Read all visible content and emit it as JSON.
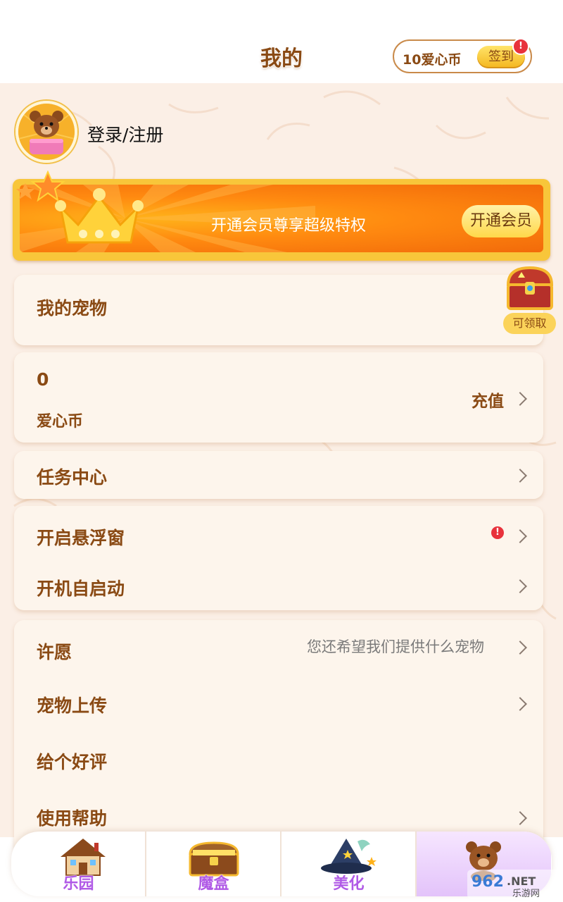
{
  "header": {
    "title": "我的",
    "coin_label": "10爱心币",
    "signin_label": "签到",
    "signin_badge": "!"
  },
  "profile": {
    "login_label": "登录/注册"
  },
  "vip": {
    "text": "开通会员尊享超级特权",
    "button_label": "开通会员"
  },
  "pets": {
    "label": "我的宠物",
    "chest_label": "可领取"
  },
  "coins": {
    "value": "0",
    "label": "爱心币",
    "recharge_label": "充值"
  },
  "menu": {
    "task_center": "任务中心",
    "floating_window": "开启悬浮窗",
    "floating_badge": "!",
    "auto_start": "开机自启动",
    "wish": "许愿",
    "wish_hint": "您还希望我们提供什么宠物",
    "pet_upload": "宠物上传",
    "good_review": "给个好评",
    "help": "使用帮助"
  },
  "tabs": [
    {
      "label": "乐园",
      "icon": "house-icon"
    },
    {
      "label": "魔盒",
      "icon": "treasure-box-icon"
    },
    {
      "label": "美化",
      "icon": "wizard-hat-icon"
    },
    {
      "label": "",
      "icon": "bear-icon",
      "active": true
    }
  ],
  "watermark": {
    "brand": "962.NET",
    "sub": "乐游网"
  },
  "colors": {
    "accent_brown": "#8a4a14",
    "vip_orange": "#f26a0a",
    "tab_purple": "#b05ae6",
    "badge_red": "#e8323c",
    "card_bg": "#fdf5ec"
  }
}
